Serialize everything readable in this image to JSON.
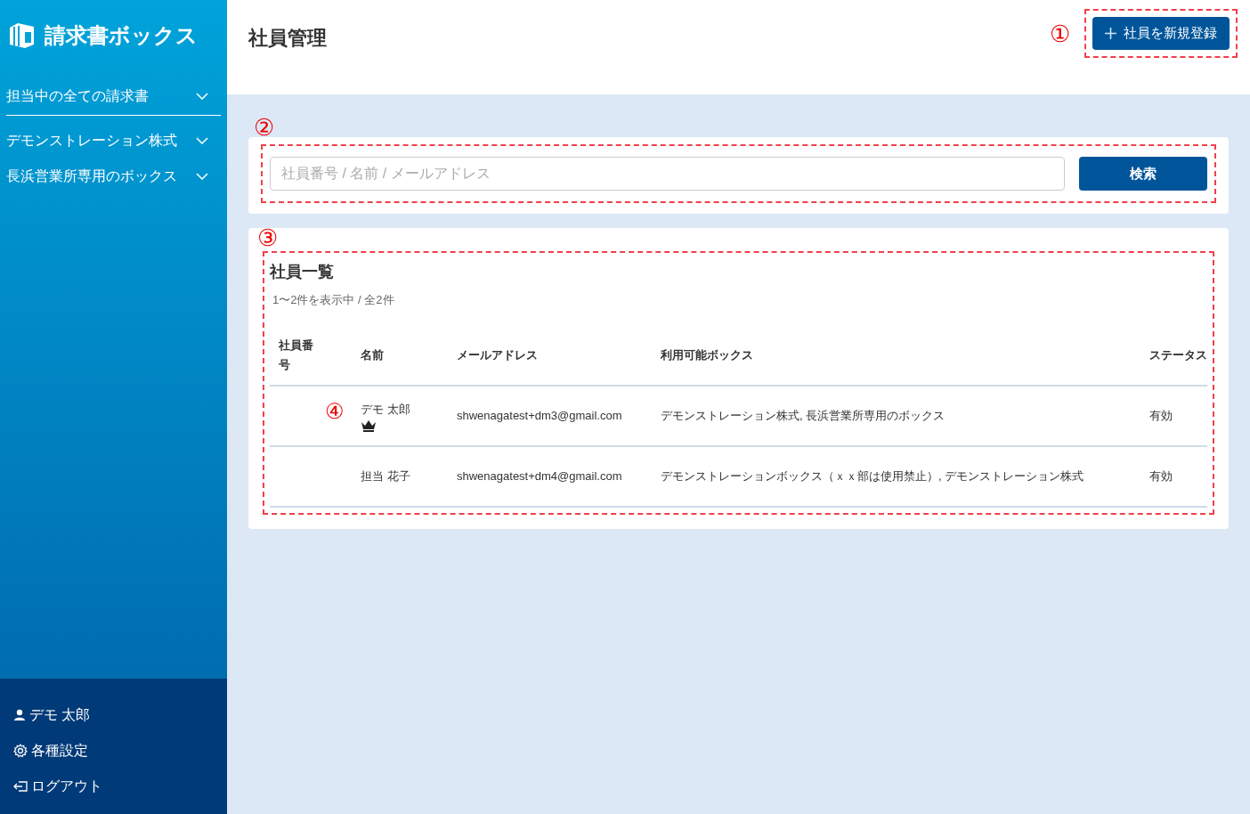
{
  "sidebar": {
    "logo": "請求書ボックス",
    "items": [
      {
        "label": "担当中の全ての請求書",
        "expanded": false
      },
      {
        "label": "デモンストレーション株式",
        "expanded": false
      },
      {
        "label": "長浜営業所専用のボックス",
        "expanded": false
      }
    ],
    "footer": [
      {
        "kind": "user",
        "label": "デモ 太郎"
      },
      {
        "kind": "settings",
        "label": "各種設定"
      },
      {
        "kind": "logout",
        "label": "ログアウト"
      }
    ]
  },
  "header": {
    "title": "社員管理",
    "add_button": "社員を新規登録"
  },
  "search": {
    "placeholder": "社員番号 / 名前 / メールアドレス",
    "button": "検索"
  },
  "list": {
    "title": "社員一覧",
    "summary": "1〜2件を表示中 / 全2件",
    "columns": [
      "社員番号",
      "名前",
      "メールアドレス",
      "利用可能ボックス",
      "ステータス"
    ],
    "rows": [
      {
        "number": "",
        "name": "デモ 太郎",
        "admin": true,
        "email": "shwenagatest+dm3@gmail.com",
        "boxes": "デモンストレーション株式, 長浜営業所専用のボックス",
        "status": "有効"
      },
      {
        "number": "",
        "name": "担当 花子",
        "admin": false,
        "email": "shwenagatest+dm4@gmail.com",
        "boxes": "デモンストレーションボックス（ｘｘ部は使用禁止）, デモンストレーション株式",
        "status": "有効"
      }
    ]
  },
  "annotations": [
    "①",
    "②",
    "③",
    "④"
  ]
}
